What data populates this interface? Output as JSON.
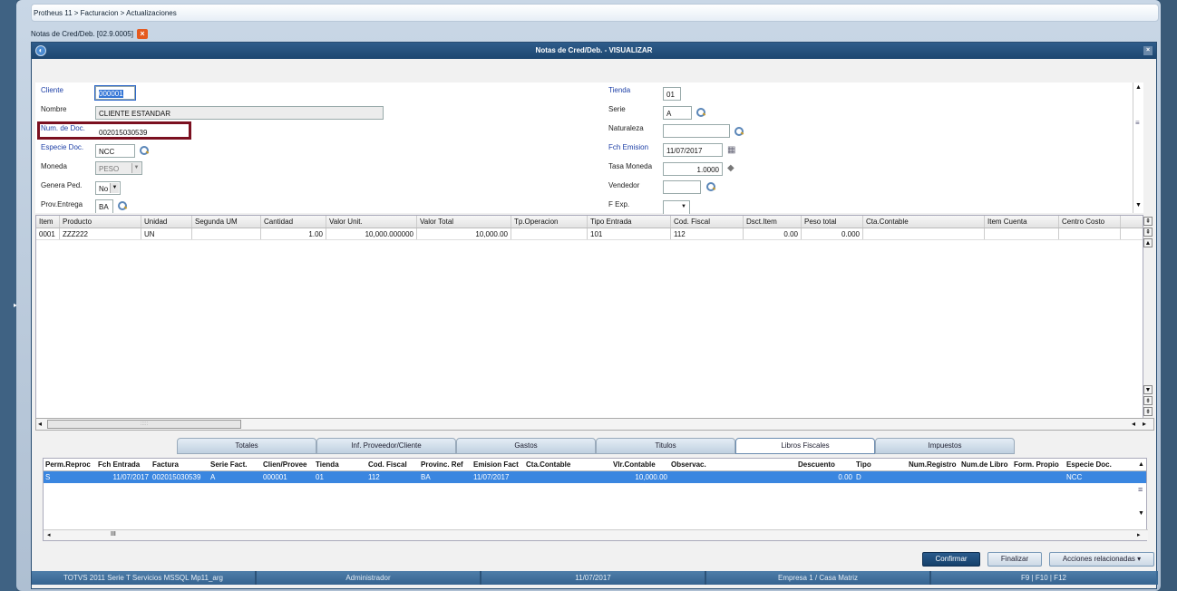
{
  "breadcrumb": "Protheus 11 > Facturacion > Actualizaciones",
  "doc_tab": "Notas de Cred/Deb. [02.9.0005]",
  "window_title": "Notas de Cred/Deb. - VISUALIZAR",
  "form": {
    "cliente_label": "Cliente",
    "cliente_value": "000001",
    "nombre_label": "Nombre",
    "nombre_value": "CLIENTE ESTANDAR",
    "numdoc_label": "Num. de Doc.",
    "numdoc_value": "002015030539",
    "especie_label": "Especie Doc.",
    "especie_value": "NCC",
    "moneda_label": "Moneda",
    "moneda_value": "PESO",
    "genera_label": "Genera Ped.",
    "genera_value": "No",
    "prov_label": "Prov.Entrega",
    "prov_value": "BA",
    "tienda_label": "Tienda",
    "tienda_value": "01",
    "serie_label": "Serie",
    "serie_value": "A",
    "naturaleza_label": "Naturaleza",
    "naturaleza_value": "",
    "fch_label": "Fch Emision",
    "fch_value": "11/07/2017",
    "tasa_label": "Tasa Moneda",
    "tasa_value": "1.0000",
    "vendedor_label": "Vendedor",
    "vendedor_value": "",
    "fexp_label": "F Exp.",
    "fexp_value": ""
  },
  "items": {
    "headers": [
      "Item",
      "Producto",
      "Unidad",
      "Segunda UM",
      "Cantidad",
      "Valor Unit.",
      "Valor Total",
      "Tp.Operacion",
      "Tipo Entrada",
      "Cod. Fiscal",
      "Dsct.Item",
      "Peso total",
      "Cta.Contable",
      "Item Cuenta",
      "Centro Costo"
    ],
    "rows": [
      [
        "0001",
        "ZZZ222",
        "UN",
        "",
        "1.00",
        "10,000.000000",
        "10,000.00",
        "",
        "101",
        "112",
        "0.00",
        "0.000",
        "",
        "",
        ""
      ]
    ]
  },
  "tabs": [
    "Totales",
    "Inf. Proveedor/Cliente",
    "Gastos",
    "Titulos",
    "Libros Fiscales",
    "Impuestos"
  ],
  "active_tab": "Libros Fiscales",
  "libros": {
    "headers": [
      "Perm.Reproc",
      "Fch Entrada",
      "Factura",
      "Serie Fact.",
      "Clien/Provee",
      "Tienda",
      "Cod. Fiscal",
      "Provinc. Ref",
      "Emision Fact",
      "Cta.Contable",
      "Vlr.Contable",
      "Observac.",
      "Descuento",
      "Tipo",
      "Num.Registro",
      "Num.de Libro",
      "Form. Propio",
      "Especie Doc. F"
    ],
    "rows": [
      [
        "S",
        "11/07/2017",
        "002015030539",
        "A",
        "000001",
        "01",
        "112",
        "BA",
        "11/07/2017",
        "",
        "10,000.00",
        "",
        "0.00",
        "D",
        "",
        "",
        "",
        "NCC"
      ]
    ]
  },
  "buttons": {
    "confirmar": "Confirmar",
    "finalizar": "Finalizar",
    "acciones": "Acciones relacionadas"
  },
  "status": [
    "TOTVS 2011 Serie T Servicios MSSQL Mp11_arg",
    "Administrador",
    "11/07/2017",
    "Empresa 1 / Casa Matriz",
    "F9 | F10 | F12"
  ],
  "scroll_thumb": "III",
  "scroll_thumb2": ":::::"
}
